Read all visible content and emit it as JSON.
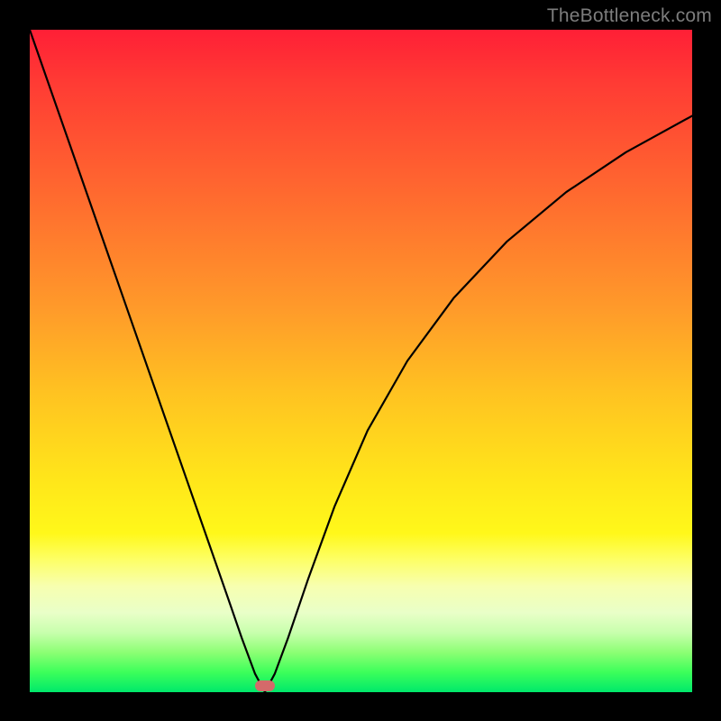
{
  "watermark": "TheBottleneck.com",
  "marker_color": "#d46a6a",
  "chart_data": {
    "type": "line",
    "title": "",
    "xlabel": "",
    "ylabel": "",
    "xlim": [
      0,
      100
    ],
    "ylim": [
      0,
      100
    ],
    "minimum_at_x_fraction": 0.355,
    "series": [
      {
        "name": "bottleneck-curve",
        "x_fraction": [
          0.0,
          0.03,
          0.06,
          0.09,
          0.12,
          0.15,
          0.18,
          0.21,
          0.24,
          0.27,
          0.3,
          0.32,
          0.34,
          0.355,
          0.37,
          0.39,
          0.42,
          0.46,
          0.51,
          0.57,
          0.64,
          0.72,
          0.81,
          0.9,
          1.0
        ],
        "y_fraction": [
          0.0,
          0.086,
          0.172,
          0.258,
          0.344,
          0.43,
          0.516,
          0.602,
          0.688,
          0.774,
          0.86,
          0.918,
          0.972,
          1.0,
          0.972,
          0.918,
          0.83,
          0.72,
          0.605,
          0.5,
          0.405,
          0.32,
          0.245,
          0.185,
          0.13
        ]
      }
    ],
    "gradient_stops": [
      {
        "pos": 0.0,
        "color": "#ff1f36"
      },
      {
        "pos": 0.25,
        "color": "#ff6a2f"
      },
      {
        "pos": 0.55,
        "color": "#ffc321"
      },
      {
        "pos": 0.76,
        "color": "#fff81a"
      },
      {
        "pos": 0.88,
        "color": "#e9ffc8"
      },
      {
        "pos": 1.0,
        "color": "#00e86b"
      }
    ]
  }
}
